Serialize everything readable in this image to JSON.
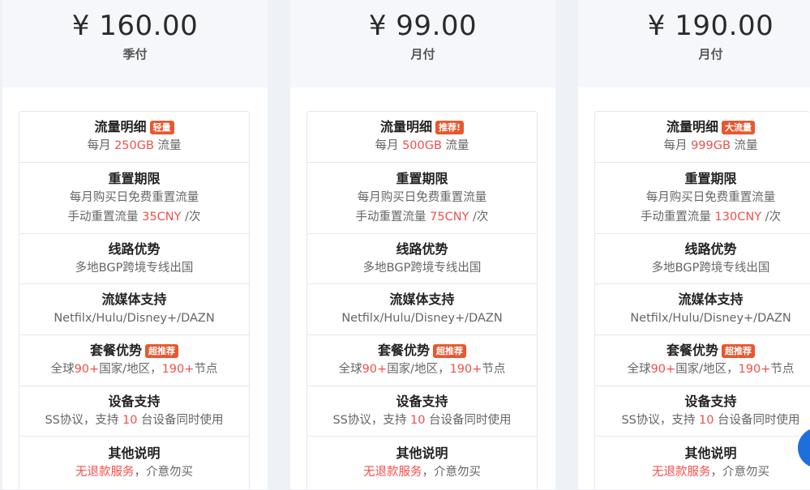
{
  "plans": [
    {
      "price": "¥ 160.00",
      "period": "季付",
      "traffic": {
        "title": "流量明细",
        "badge": "轻量",
        "pre": "每月 ",
        "value": "250GB",
        "post": " 流量"
      },
      "reset": {
        "title": "重置期限",
        "line1": "每月购买日免费重置流量",
        "pre": "手动重置流量 ",
        "value": "35CNY",
        "post": " /次"
      },
      "route": {
        "title": "线路优势",
        "text": "多地BGP跨境专线出国"
      },
      "media": {
        "title": "流媒体支持",
        "text": "Netfilx/Hulu/Disney+/DAZN"
      },
      "advantage": {
        "title": "套餐优势",
        "badge": "超推荐",
        "pre": "全球",
        "countries": "90+",
        "mid": "国家/地区，",
        "nodes": "190+",
        "post": "节点"
      },
      "devices": {
        "title": "设备支持",
        "pre": "SS协议，支持 ",
        "value": "10",
        "post": " 台设备同时使用"
      },
      "notes": {
        "title": "其他说明",
        "warn": "无退款服务",
        "post": "，介意勿买"
      }
    },
    {
      "price": "¥ 99.00",
      "period": "月付",
      "traffic": {
        "title": "流量明细",
        "badge": "推荐!",
        "pre": "每月 ",
        "value": "500GB",
        "post": " 流量"
      },
      "reset": {
        "title": "重置期限",
        "line1": "每月购买日免费重置流量",
        "pre": "手动重置流量 ",
        "value": "75CNY",
        "post": " /次"
      },
      "route": {
        "title": "线路优势",
        "text": "多地BGP跨境专线出国"
      },
      "media": {
        "title": "流媒体支持",
        "text": "Netfilx/Hulu/Disney+/DAZN"
      },
      "advantage": {
        "title": "套餐优势",
        "badge": "超推荐",
        "pre": "全球",
        "countries": "90+",
        "mid": "国家/地区，",
        "nodes": "190+",
        "post": "节点"
      },
      "devices": {
        "title": "设备支持",
        "pre": "SS协议，支持 ",
        "value": "10",
        "post": " 台设备同时使用"
      },
      "notes": {
        "title": "其他说明",
        "warn": "无退款服务",
        "post": "，介意勿买"
      }
    },
    {
      "price": "¥ 190.00",
      "period": "月付",
      "traffic": {
        "title": "流量明细",
        "badge": "大流量",
        "pre": "每月 ",
        "value": "999GB",
        "post": " 流量"
      },
      "reset": {
        "title": "重置期限",
        "line1": "每月购买日免费重置流量",
        "pre": "手动重置流量 ",
        "value": "130CNY",
        "post": " /次"
      },
      "route": {
        "title": "线路优势",
        "text": "多地BGP跨境专线出国"
      },
      "media": {
        "title": "流媒体支持",
        "text": "Netfilx/Hulu/Disney+/DAZN"
      },
      "advantage": {
        "title": "套餐优势",
        "badge": "超推荐",
        "pre": "全球",
        "countries": "90+",
        "mid": "国家/地区，",
        "nodes": "190+",
        "post": "节点"
      },
      "devices": {
        "title": "设备支持",
        "pre": "SS协议，支持 ",
        "value": "10",
        "post": " 台设备同时使用"
      },
      "notes": {
        "title": "其他说明",
        "warn": "无退款服务",
        "post": "，介意勿买"
      }
    }
  ],
  "colors": {
    "accent": "#f0504a",
    "badge": "#e8572e",
    "fab": "#1e6fdc",
    "header_bg": "#f5f7fa",
    "page_bg": "#eef1f6"
  }
}
